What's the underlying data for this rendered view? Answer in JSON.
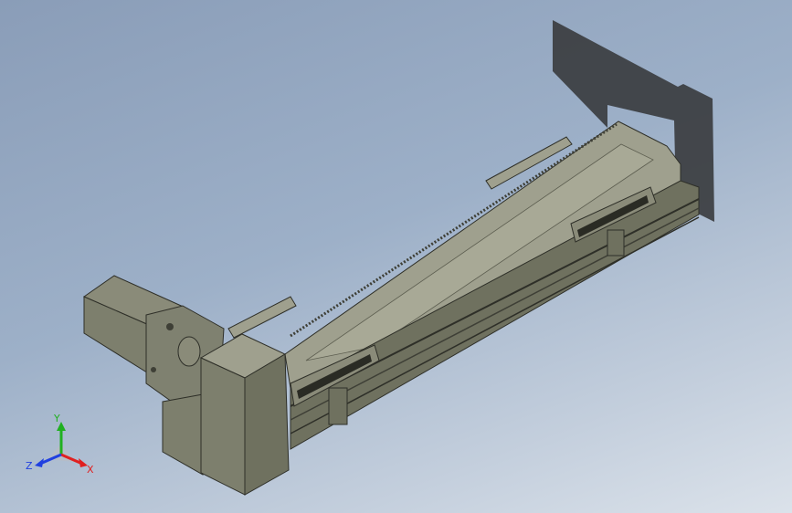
{
  "viewport": {
    "background_top": "#8a9db8",
    "background_bottom": "#dbe2ea"
  },
  "model": {
    "parts": [
      "linear-actuator-body",
      "carriage-front",
      "carriage-rear",
      "motor-housing",
      "motor-flange",
      "reducer-cover",
      "mounting-plate-shadow",
      "mounting-bracket-left",
      "mounting-bracket-right"
    ],
    "colors": {
      "rail_top": "#9fa08e",
      "rail_side": "#6f715f",
      "rail_dark": "#3e3f36",
      "motor": "#7d7f6d",
      "cover": "#8a8b79",
      "shadow": "#3b3d40"
    }
  },
  "triad": {
    "x_label": "X",
    "y_label": "Y",
    "z_label": "Z",
    "x_color": "#e02020",
    "y_color": "#20b020",
    "z_color": "#2040e0"
  }
}
